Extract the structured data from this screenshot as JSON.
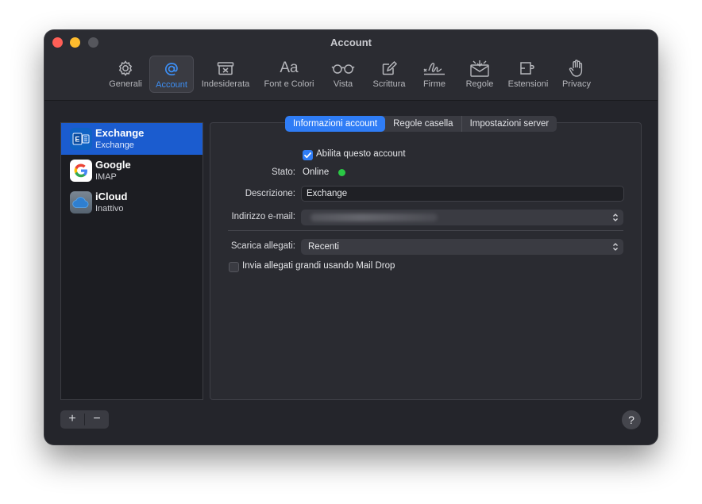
{
  "window": {
    "title": "Account"
  },
  "toolbar": {
    "items": [
      {
        "label": "Generali",
        "icon": "gear-icon"
      },
      {
        "label": "Account",
        "icon": "at-sign-icon",
        "active": true
      },
      {
        "label": "Indesiderata",
        "icon": "junk-tray-icon"
      },
      {
        "label": "Font e Colori",
        "icon": "font-icon"
      },
      {
        "label": "Vista",
        "icon": "glasses-icon"
      },
      {
        "label": "Scrittura",
        "icon": "compose-icon"
      },
      {
        "label": "Firme",
        "icon": "signature-icon"
      },
      {
        "label": "Regole",
        "icon": "rules-envelope-icon"
      },
      {
        "label": "Estensioni",
        "icon": "puzzle-icon"
      },
      {
        "label": "Privacy",
        "icon": "hand-icon"
      }
    ],
    "font_glyph": "Aa"
  },
  "accounts": [
    {
      "name": "Exchange",
      "type": "Exchange",
      "selected": true,
      "icon": "exchange-icon"
    },
    {
      "name": "Google",
      "type": "IMAP",
      "icon": "google-icon"
    },
    {
      "name": "iCloud",
      "type": "Inattivo",
      "icon": "icloud-icon"
    }
  ],
  "tabs": [
    {
      "label": "Informazioni account",
      "active": true
    },
    {
      "label": "Regole casella"
    },
    {
      "label": "Impostazioni server"
    }
  ],
  "form": {
    "enable_label": "Abilita questo account",
    "enable_checked": true,
    "status_label": "Stato:",
    "status_value": "Online",
    "description_label": "Descrizione:",
    "description_value": "Exchange",
    "email_label": "Indirizzo e-mail:",
    "download_label": "Scarica allegati:",
    "download_value": "Recenti",
    "maildrop_label": "Invia allegati grandi usando Mail Drop",
    "maildrop_checked": false
  },
  "footer": {
    "add_label": "+",
    "remove_label": "−",
    "help_label": "?"
  },
  "colors": {
    "accent": "#2f7df6",
    "selection": "#1b5ccf",
    "online": "#2ac845"
  }
}
